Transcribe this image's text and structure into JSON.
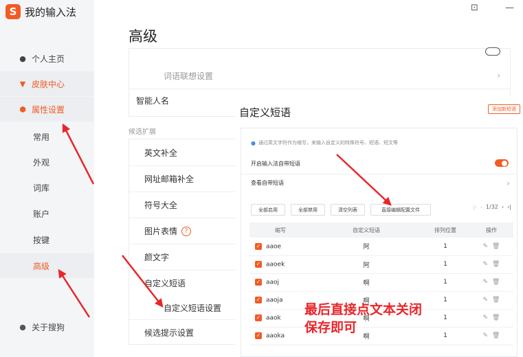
{
  "app": {
    "logo_glyph": "S",
    "title": "我的输入法"
  },
  "window": {
    "minimize": "—"
  },
  "sidebar": {
    "items": [
      {
        "label": "个人主页",
        "icon": "user-icon"
      },
      {
        "label": "皮肤中心",
        "icon": "shirt-icon"
      },
      {
        "label": "属性设置",
        "icon": "settings-hex-icon"
      }
    ],
    "sub_items": [
      "常用",
      "外观",
      "词库",
      "账户",
      "按键",
      "高级"
    ],
    "about": {
      "label": "关于搜狗",
      "icon": "info-icon"
    }
  },
  "main": {
    "page_title": "高级",
    "rows_top": [
      {
        "label": "词语联想设置"
      },
      {
        "label": "智能人名"
      }
    ],
    "section_label": "候选扩展",
    "rows": [
      {
        "label": "英文补全"
      },
      {
        "label": "网址邮箱补全"
      },
      {
        "label": "符号大全"
      },
      {
        "label": "图片表情",
        "help": "?"
      },
      {
        "label": "颜文字"
      },
      {
        "label": "自定义短语"
      },
      {
        "label": "自定义短语设置"
      },
      {
        "label": "候选提示设置"
      }
    ]
  },
  "dialog": {
    "title": "自定义短语",
    "add_button": "添加新短语",
    "hint": "通过英文字符作为缩写，来输入自定义的特殊符号、短语、短文等",
    "enable_label": "开启输入法自带短语",
    "view_label": "查看自带短语",
    "toolbar": [
      "全部启用",
      "全部禁用",
      "清空列表",
      "直接编辑配置文件"
    ],
    "pager": {
      "first": "|‹",
      "prev": "‹",
      "text": "1/32",
      "next": "›",
      "last": "›|"
    },
    "table": {
      "headers": [
        "缩写",
        "自定义短语",
        "排列位置",
        "操作"
      ],
      "rows": [
        {
          "abbr": "aaoe",
          "phrase": "阿",
          "pos": "1"
        },
        {
          "abbr": "aaoek",
          "phrase": "阿",
          "pos": "1"
        },
        {
          "abbr": "aaoj",
          "phrase": "啊",
          "pos": "1"
        },
        {
          "abbr": "aaoja",
          "phrase": "啊",
          "pos": "1"
        },
        {
          "abbr": "aaok",
          "phrase": "啊",
          "pos": "1"
        },
        {
          "abbr": "aaoka",
          "phrase": "啊",
          "pos": "1"
        }
      ]
    }
  },
  "annotation": {
    "line1": "最后直接点文本关闭",
    "line2": "保存即可"
  },
  "colors": {
    "accent": "#f25b24",
    "arrow": "#e8262a"
  }
}
